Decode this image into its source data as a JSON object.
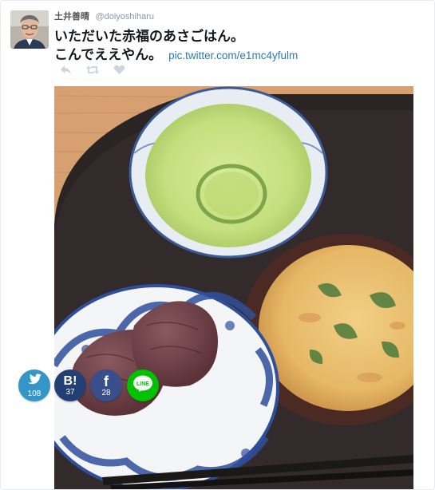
{
  "tweet": {
    "display_name": "土井善晴",
    "screen_name": "@doiyoshiharu",
    "text_line1": "いただいた赤福のあさごはん。",
    "text_line2": "こんでええやん。",
    "link": "pic.twitter.com/e1mc4yfulm",
    "actions": [
      "reply-icon",
      "retweet-icon",
      "like-icon"
    ]
  },
  "share": {
    "twitter": {
      "icon": "twitter-bird-icon",
      "count": "108"
    },
    "hatena": {
      "glyph": "B!",
      "count": "37"
    },
    "facebook": {
      "glyph": "f",
      "count": "28"
    },
    "line": {
      "glyph": "LINE"
    }
  },
  "colors": {
    "link": "#2b7bb9",
    "twitter": "#3496c6",
    "hatena": "#243f73",
    "facebook": "#384f8c",
    "line": "#00c300"
  }
}
